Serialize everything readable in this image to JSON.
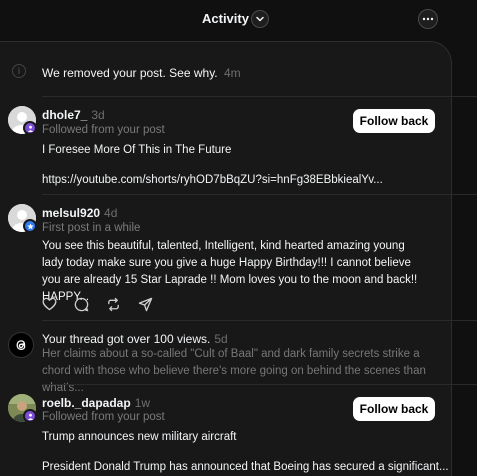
{
  "header": {
    "title": "Activity"
  },
  "notifications": {
    "removed": {
      "text": "We removed your post. See why.",
      "time": "4m"
    },
    "n1": {
      "username": "dhole7_",
      "time": "3d",
      "subtitle": "Followed from your post",
      "line1": "I Foresee More Of This in The Future",
      "line2": "https://youtube.com/shorts/ryhOD7bBqZU?si=hnFg38EBbkiealYv...",
      "button": "Follow back"
    },
    "n2": {
      "username": "melsul920",
      "time": "4d",
      "subtitle": "First post in a while",
      "text": "You see this beautiful, talented, Intelligent, kind hearted amazing young lady today make sure you give a huge Happy Birthday!!! I cannot believe you are already 15 Star Laprade !! Mom loves you to the moon and back!! HAPPY..."
    },
    "n3": {
      "title": "Your thread got over 100 views.",
      "time": "5d",
      "text": "Her claims about a so-called \"Cult of Baal\" and dark family secrets strike a chord with those who believe there's more going on behind the scenes than what's..."
    },
    "n4": {
      "username": "roelb._dapadap",
      "time": "1w",
      "subtitle": "Followed from your post",
      "line1": "Trump announces new military aircraft",
      "line2": "President Donald Trump has announced that Boeing has secured a significant...",
      "button": "Follow back"
    }
  },
  "icons": {
    "chevron": "chevron-down-icon",
    "more": "more-icon",
    "like": "heart-icon",
    "reply": "comment-icon",
    "repost": "repost-icon",
    "share": "send-icon",
    "threads": "threads-logo-icon"
  }
}
